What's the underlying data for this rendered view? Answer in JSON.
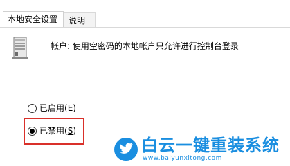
{
  "tabs": [
    {
      "label": "本地安全设置",
      "active": true
    },
    {
      "label": "说明",
      "active": false
    }
  ],
  "policy": {
    "icon": "server-icon",
    "description": "帐户: 使用空密码的本地帐户只允许进行控制台登录"
  },
  "options": [
    {
      "label": "已启用",
      "accel": "E",
      "checked": false
    },
    {
      "label": "已禁用",
      "accel": "S",
      "checked": true
    }
  ],
  "highlight_color": "#d9302a",
  "watermark": {
    "logo": "twitter-bird-icon",
    "text": "白云一键重装系统",
    "url": "www.baiyunxitong.com",
    "color": "#1a8ee0"
  }
}
